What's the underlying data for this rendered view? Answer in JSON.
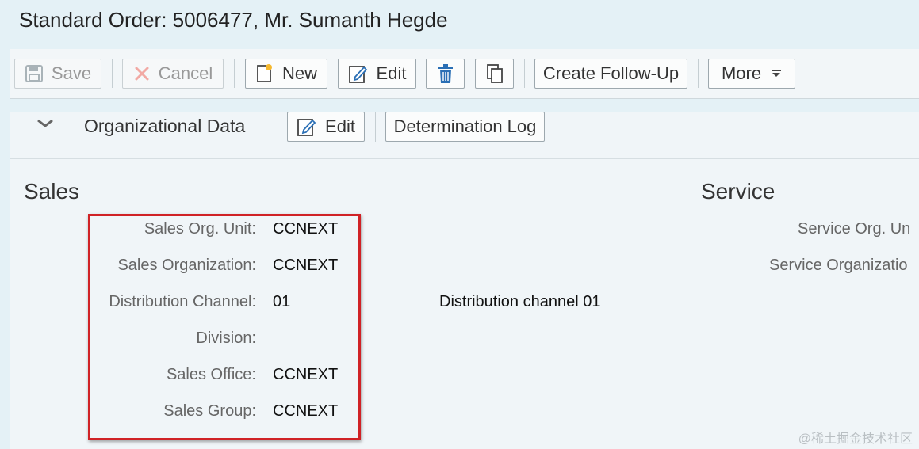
{
  "window": {
    "title": "Standard Order: 5006477, Mr. Sumanth Hegde"
  },
  "toolbar": {
    "save": "Save",
    "cancel": "Cancel",
    "new": "New",
    "edit": "Edit",
    "create_follow_up": "Create Follow-Up",
    "more": "More"
  },
  "org_section": {
    "title": "Organizational Data",
    "edit": "Edit",
    "determination_log": "Determination Log"
  },
  "sales": {
    "title": "Sales",
    "fields": [
      {
        "label": "Sales Org. Unit:",
        "value": "CCNEXT",
        "description": ""
      },
      {
        "label": "Sales Organization:",
        "value": "CCNEXT",
        "description": ""
      },
      {
        "label": "Distribution Channel:",
        "value": "01",
        "description": "Distribution channel 01"
      },
      {
        "label": "Division:",
        "value": "",
        "description": ""
      },
      {
        "label": "Sales Office:",
        "value": "CCNEXT",
        "description": ""
      },
      {
        "label": "Sales Group:",
        "value": "CCNEXT",
        "description": ""
      }
    ]
  },
  "service": {
    "title": "Service",
    "fields": [
      {
        "label": "Service Org. Un"
      },
      {
        "label": "Service Organizatio"
      }
    ]
  },
  "icons": {
    "save": "floppy-disk-icon",
    "cancel": "x-icon",
    "new": "new-document-icon",
    "edit": "pencil-document-icon",
    "delete": "trash-icon",
    "copy": "copy-icon",
    "more": "caret-down-icon",
    "collapse": "chevron-down-icon"
  },
  "colors": {
    "highlight": "#d02226",
    "delete_icon": "#2a6fb5"
  },
  "watermark": "@稀土掘金技术社区"
}
